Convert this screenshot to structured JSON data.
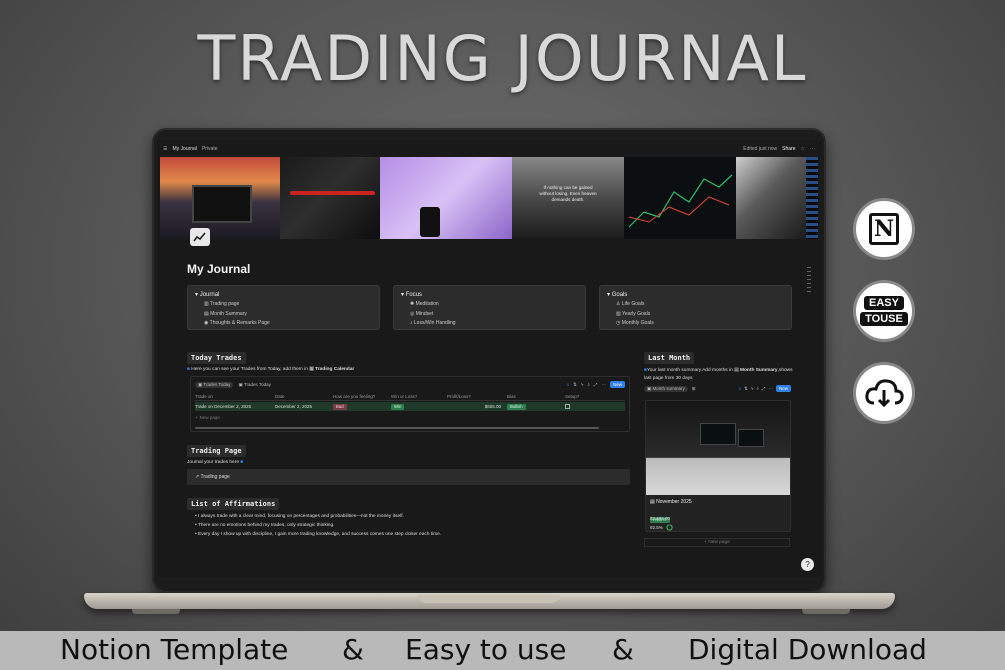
{
  "headline": "TRADING JOURNAL",
  "topbar": {
    "breadcrumb": "My Journal",
    "privacy": "Private",
    "edited": "Edited just now",
    "share": "Share"
  },
  "cover": {
    "quote_line1": "If nothing can be gained",
    "quote_line2": "without losing. Even heaven",
    "quote_line3": "demands death."
  },
  "page": {
    "title": "My Journal"
  },
  "cards": [
    {
      "header": "Journal",
      "items": [
        "Trading page",
        "Month Summary",
        "Thoughts & Remarks Page"
      ]
    },
    {
      "header": "Focus",
      "items": [
        "Meditation",
        "Mindset",
        "Loss/Win Handling"
      ]
    },
    {
      "header": "Goals",
      "items": [
        "Life Goals",
        "Yearly Goals",
        "Monthly Goals"
      ]
    }
  ],
  "today": {
    "heading": "Today Trades",
    "desc_pre": "Here you can see your Trades from Today, add them in",
    "desc_link": "Trading Calendar",
    "views": [
      "Trades Today",
      "Trades Today"
    ],
    "new_label": "New",
    "columns": [
      "Trade on",
      "Date",
      "How are you feeling?",
      "Win or Loss?",
      "Profit/Loss?",
      "Bias",
      "Setup?"
    ],
    "row": {
      "name": "Trade on December 2, 2025",
      "date": "December 2, 2025",
      "feeling": "Bad",
      "result": "Win",
      "profit": "$605.00",
      "bias": "Bullish"
    },
    "new_page": "New page"
  },
  "trading_page": {
    "heading": "Trading Page",
    "desc": "Journal your trades here",
    "button": "Trading page"
  },
  "affirmations": {
    "heading": "List of Affirmations",
    "items": [
      "I always trade with a clear mind, focusing on percentages and probabilities—not the money itself.",
      "There are no emotions behind my trades, only strategic thinking.",
      "Every day I show up with discipline, I gain more trading knowledge, and success comes one step closer each time."
    ]
  },
  "last_month": {
    "heading": "Last Month",
    "desc_pre": "Your last month summary.Add months in",
    "desc_link": "Month Summary",
    "desc_post": ",shows last page from 30 days",
    "view": "Month summary",
    "new_label": "New",
    "card_title": "November 2025",
    "tag": "PROFIT",
    "amount": "$2,486.00",
    "percent": "92.5%",
    "progress": 0.925,
    "new_page": "New page"
  },
  "badges": {
    "easy_line1": "EASY",
    "easy_line2": "TOUSE"
  },
  "footer": {
    "left": "Notion Template",
    "amp1": "&",
    "middle": "Easy to use",
    "amp2": "&",
    "right": "Digital Download"
  },
  "colors": {
    "accent": "#2f80ed",
    "win": "#2e7d4f",
    "bad": "#7a3b45",
    "row_hl": "#1f3a2a"
  }
}
